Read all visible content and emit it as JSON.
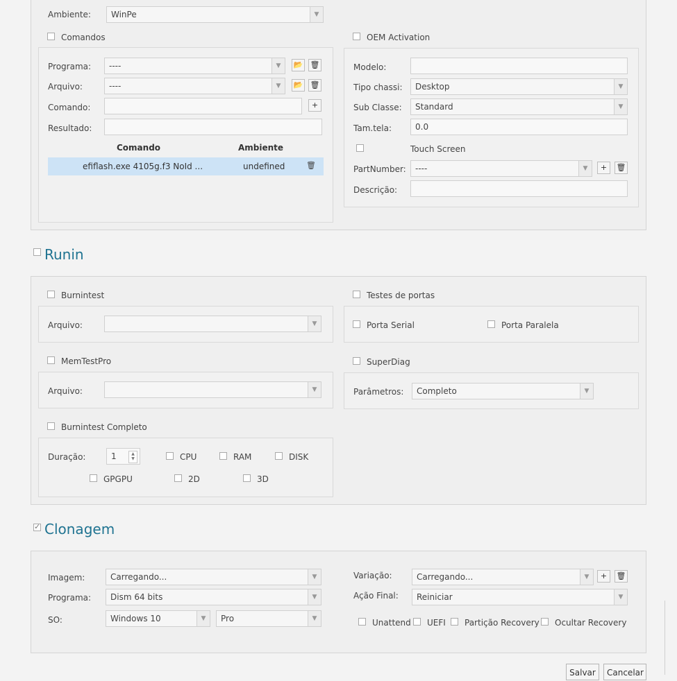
{
  "top": {
    "ambiente_label": "Ambiente:",
    "ambiente_value": "WinPe",
    "comandos": {
      "label": "Comandos",
      "programa_label": "Programa:",
      "programa_value": "----",
      "arquivo_label": "Arquivo:",
      "arquivo_value": "----",
      "comando_label": "Comando:",
      "comando_value": "",
      "resultado_label": "Resultado:",
      "resultado_value": "",
      "table": {
        "headers": [
          "Comando",
          "Ambiente"
        ],
        "rows": [
          {
            "comando": "efiflash.exe 4105g.f3 NoId ...",
            "ambiente": "undefined"
          }
        ]
      }
    },
    "oem": {
      "label": "OEM Activation",
      "modelo_label": "Modelo:",
      "modelo_value": "",
      "tipo_chassi_label": "Tipo chassi:",
      "tipo_chassi_value": "Desktop",
      "sub_classe_label": "Sub Classe:",
      "sub_classe_value": "Standard",
      "tam_tela_label": "Tam.tela:",
      "tam_tela_value": "0.0",
      "touch_label": "Touch Screen",
      "partnumber_label": "PartNumber:",
      "partnumber_value": "----",
      "descricao_label": "Descrição:",
      "descricao_value": ""
    }
  },
  "runin": {
    "title": "Runin",
    "burnintest": {
      "label": "Burnintest",
      "arquivo_label": "Arquivo:",
      "arquivo_value": ""
    },
    "memtest": {
      "label": "MemTestPro",
      "arquivo_label": "Arquivo:",
      "arquivo_value": ""
    },
    "burnin_completo": {
      "label": "Burnintest Completo",
      "duracao_label": "Duração:",
      "duracao_value": "1",
      "cpu": "CPU",
      "ram": "RAM",
      "disk": "DISK",
      "gpgpu": "GPGPU",
      "d2": "2D",
      "d3": "3D"
    },
    "portas": {
      "label": "Testes de portas",
      "serial": "Porta Serial",
      "paralela": "Porta Paralela"
    },
    "superdiag": {
      "label": "SuperDiag",
      "parametros_label": "Parâmetros:",
      "parametros_value": "Completo"
    }
  },
  "clonagem": {
    "title": "Clonagem",
    "checked": true,
    "imagem_label": "Imagem:",
    "imagem_value": "Carregando...",
    "programa_label": "Programa:",
    "programa_value": "Dism 64 bits",
    "so_label": "SO:",
    "so_value": "Windows 10",
    "edicao_value": "Pro",
    "variacao_label": "Variação:",
    "variacao_value": "Carregando...",
    "acao_final_label": "Ação Final:",
    "acao_final_value": "Reiniciar",
    "unattend": "Unattend",
    "uefi": "UEFI",
    "particao": "Partição Recovery",
    "ocultar": "Ocultar Recovery"
  },
  "footer": {
    "salvar": "Salvar",
    "cancelar": "Cancelar"
  }
}
